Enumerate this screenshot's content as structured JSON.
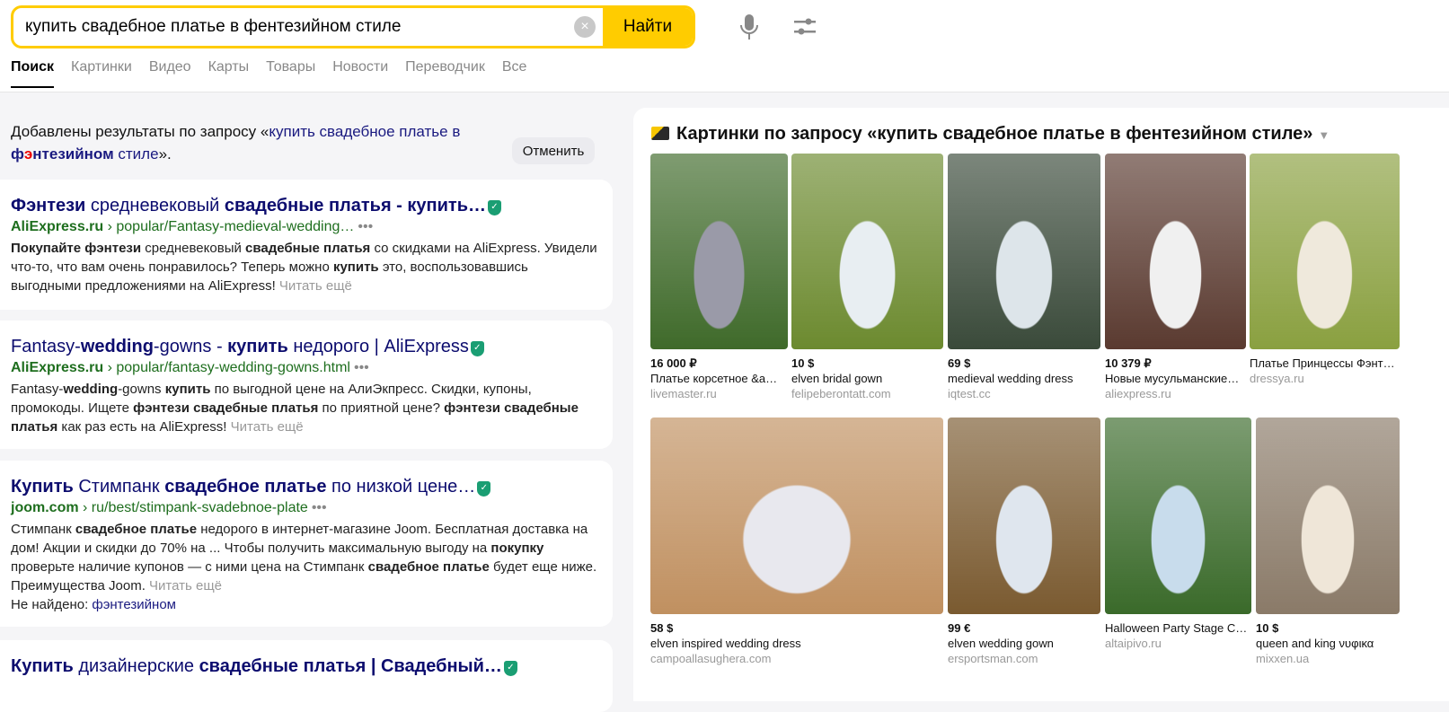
{
  "search": {
    "query": "купить свадебное платье в фентезийном стиле",
    "button": "Найти",
    "clear": "×"
  },
  "tabs": [
    "Поиск",
    "Картинки",
    "Видео",
    "Карты",
    "Товары",
    "Новости",
    "Переводчик",
    "Все"
  ],
  "notice": {
    "prefix": "Добавлены результаты по запросу «",
    "q1": "купить свадебное платье в ",
    "q2a": "ф",
    "q2b": "э",
    "q2c": "нтезийном",
    "q3": " стиле",
    "suffix": "».",
    "cancel": "Отменить"
  },
  "results": [
    {
      "t1": "Фэнтези",
      "t2": " средневековый ",
      "t3": "свадебные платья - купить…",
      "domain": "AliExpress.ru",
      "path": " › popular/Fantasy-medieval-wedding…",
      "snippet": [
        [
          "b",
          "Покупайте фэнтези"
        ],
        [
          "",
          "средневековый"
        ],
        [
          "b",
          "свадебные платья"
        ],
        [
          "",
          "со скидками на AliExpress. Увидели что-то, что вам очень понравилось? Теперь можно"
        ],
        [
          "b",
          "купить"
        ],
        [
          "",
          "это, воспользовавшись выгодными предложениями на AliExpress!"
        ]
      ],
      "more": "Читать ещё"
    },
    {
      "t1": "Fantasy-",
      "t2": "wedding",
      "t3": "-gowns - ",
      "t4": "купить",
      "t5": " недорого | AliExpress",
      "domain": "AliExpress.ru",
      "path": " › popular/fantasy-wedding-gowns.html",
      "more": "Читать ещё"
    },
    {
      "t1": "Купить",
      "t2": " Стимпанк ",
      "t3": "свадебное платье",
      "t4": " по низкой цене…",
      "domain": "joom.com",
      "path": " › ru/best/stimpank-svadebnoe-plate",
      "more": "Читать ещё",
      "not_found_label": "Не найдено: ",
      "not_found_word": "фэнтезийном"
    },
    {
      "t1": "Купить",
      "t2": " дизайнерские ",
      "t3": "свадебные платья | Свадебный…"
    }
  ],
  "images": {
    "title": "Картинки по запросу «купить свадебное платье в фентезийном стиле»",
    "items": [
      {
        "price": "16 000 ₽",
        "name": "Платье корсетное &a…",
        "domain": "livemaster.ru",
        "colors": [
          "#3f6a2a",
          "#9a9aa8"
        ]
      },
      {
        "price": "10 $",
        "name": "elven bridal gown",
        "domain": "felipeberontatt.com",
        "colors": [
          "#6c8a2f",
          "#e8eef2"
        ]
      },
      {
        "price": "69 $",
        "name": "medieval wedding dress",
        "domain": "iqtest.cc",
        "colors": [
          "#3a4a3a",
          "#dde5ea"
        ]
      },
      {
        "price": "10 379 ₽",
        "name": "Новые мусульманские…",
        "domain": "aliexpress.ru",
        "colors": [
          "#5a3a30",
          "#f0f0f0"
        ]
      },
      {
        "price": "",
        "name": "Платье Принцессы Фэнт…",
        "domain": "dressya.ru",
        "colors": [
          "#8aa040",
          "#efe9dc"
        ]
      },
      {
        "price": "58 $",
        "name": "elven inspired wedding dress",
        "domain": "campoallasughera.com",
        "colors": [
          "#c09060",
          "#e8e8ee"
        ]
      },
      {
        "price": "99 €",
        "name": "elven wedding gown",
        "domain": "ersportsman.com",
        "colors": [
          "#7a5a30",
          "#dfe6ee"
        ]
      },
      {
        "price": "",
        "name": "Halloween Party Stage C…",
        "domain": "altaipivo.ru",
        "colors": [
          "#3a6a2a",
          "#c8dcec"
        ]
      },
      {
        "price": "10 $",
        "name": "queen and king νυφικα",
        "domain": "mixxen.ua",
        "colors": [
          "#8a7a68",
          "#efe6d8"
        ]
      }
    ]
  }
}
